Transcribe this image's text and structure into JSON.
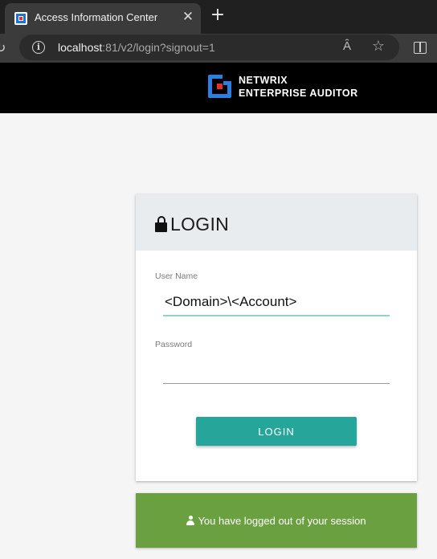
{
  "browser": {
    "tab_title": "Access Information Center",
    "close_glyph": "✕",
    "newtab_glyph": "+",
    "url_host": "localhost",
    "url_rest": ":81/v2/login?signout=1",
    "read_aloud_glyph": "Ȃ",
    "favorite_glyph": "☆",
    "refresh_glyph": "↻",
    "icons": [
      "site-favicon",
      "close-icon",
      "new-tab-icon",
      "refresh-icon",
      "info-icon",
      "read-aloud-icon",
      "favorite-star-icon",
      "split-screen-icon"
    ]
  },
  "brand": {
    "line1": "NETWRIX",
    "line2": "ENTERPRISE AUDITOR",
    "colors": {
      "blue": "#2a7fe0",
      "red": "#e2312c"
    }
  },
  "login": {
    "title": "LOGIN",
    "username_label": "User Name",
    "username_value": "<Domain>\\<Account>",
    "password_label": "Password",
    "password_value": "",
    "button_label": "LOGIN",
    "accent": "#26a69a"
  },
  "banner": {
    "message": "You have logged out of your session",
    "color": "#6ba041",
    "icon": "user-icon"
  }
}
